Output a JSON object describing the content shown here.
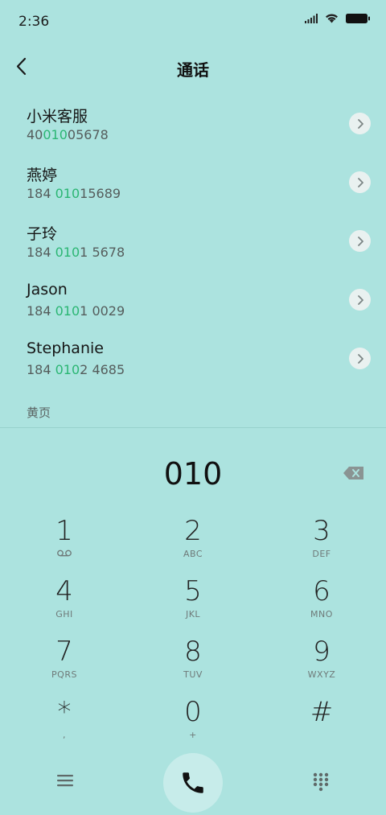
{
  "status_bar": {
    "time": "2:36"
  },
  "header": {
    "title": "通话"
  },
  "contacts": [
    {
      "name": "小米客服",
      "num_before": "40",
      "num_match": "010",
      "num_after": "05678"
    },
    {
      "name": "燕婷",
      "num_before": "184 ",
      "num_match": "010",
      "num_after": "15689"
    },
    {
      "name": "子玲",
      "num_before": "184 ",
      "num_match": "010",
      "num_after": "1 5678"
    },
    {
      "name": "Jason",
      "num_before": "184 ",
      "num_match": "010",
      "num_after": "1 0029"
    },
    {
      "name": "Stephanie",
      "num_before": "184 ",
      "num_match": "010",
      "num_after": "2 4685"
    }
  ],
  "section_label": "黄页",
  "dialed_number": "010",
  "keypad": [
    {
      "digit": "1",
      "letters": ""
    },
    {
      "digit": "2",
      "letters": "ABC"
    },
    {
      "digit": "3",
      "letters": "DEF"
    },
    {
      "digit": "4",
      "letters": "GHI"
    },
    {
      "digit": "5",
      "letters": "JKL"
    },
    {
      "digit": "6",
      "letters": "MNO"
    },
    {
      "digit": "7",
      "letters": "PQRS"
    },
    {
      "digit": "8",
      "letters": "TUV"
    },
    {
      "digit": "9",
      "letters": "WXYZ"
    },
    {
      "digit": "*",
      "letters": ","
    },
    {
      "digit": "0",
      "letters": "+"
    },
    {
      "digit": "#",
      "letters": ""
    }
  ],
  "icons": {
    "back": "chevron-left-icon",
    "detail": "chevron-right-icon",
    "backspace": "backspace-icon",
    "voicemail": "voicemail-icon",
    "menu": "menu-icon",
    "call": "phone-icon",
    "dialpad": "dialpad-icon"
  },
  "colors": {
    "background": "#ace3df",
    "match": "#2bb673"
  }
}
